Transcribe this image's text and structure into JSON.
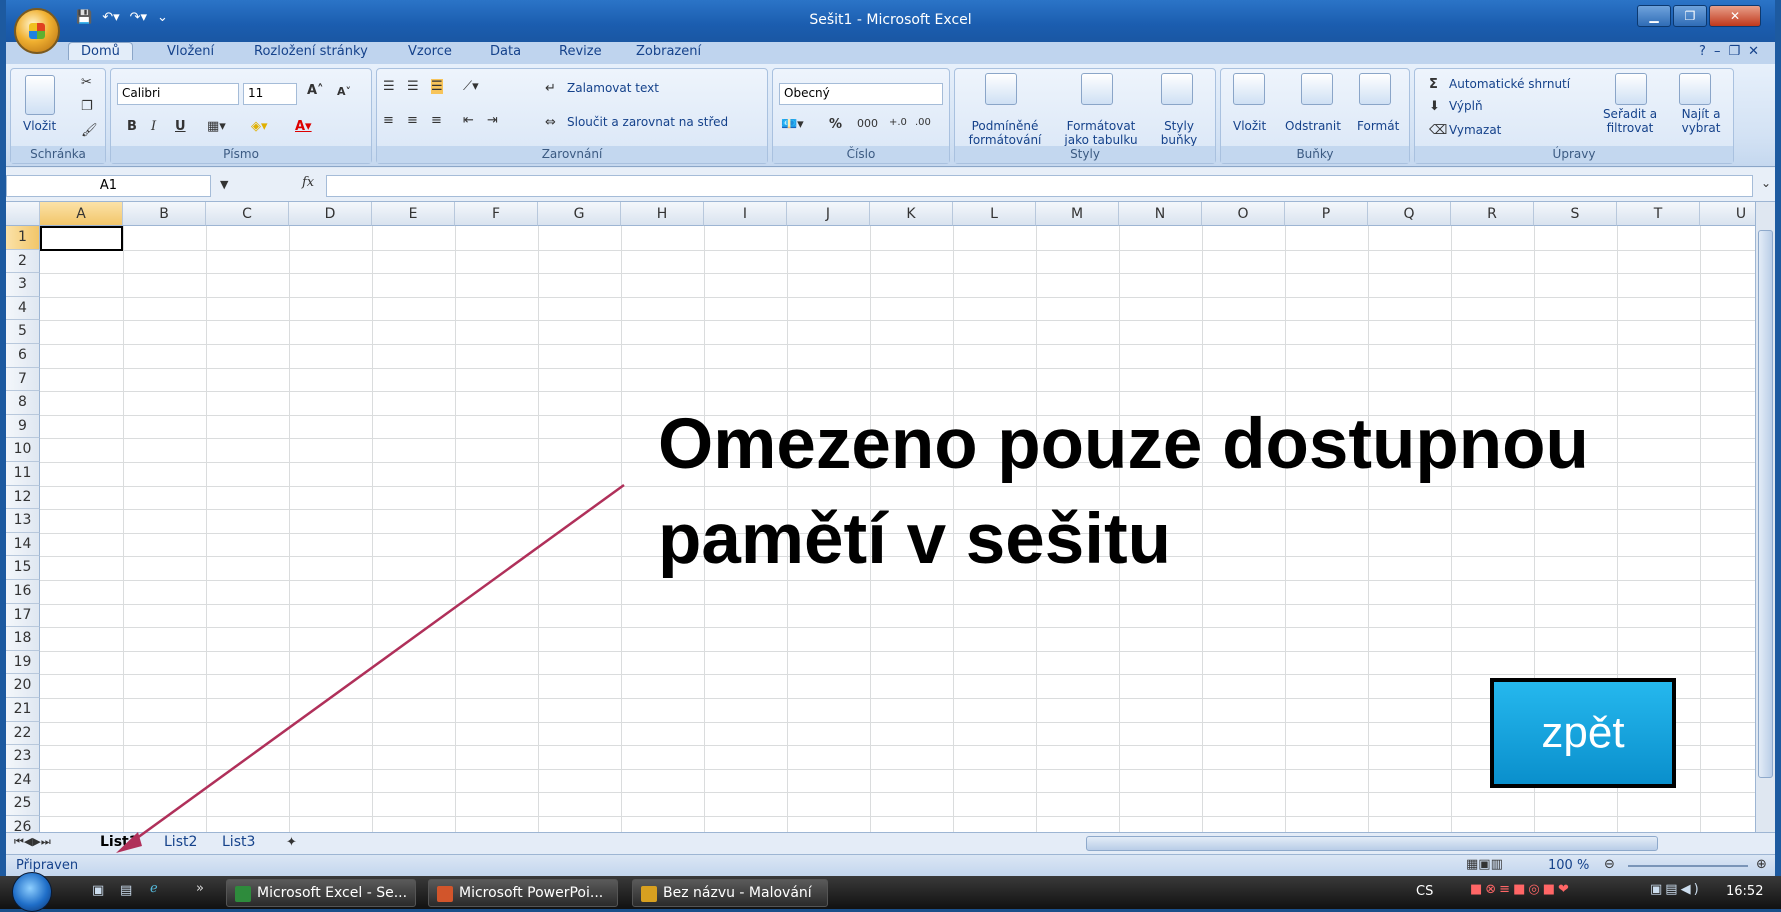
{
  "window": {
    "title": "Sešit1 - Microsoft Excel"
  },
  "ribbon_tabs": [
    "Domů",
    "Vložení",
    "Rozložení stránky",
    "Vzorce",
    "Data",
    "Revize",
    "Zobrazení"
  ],
  "ribbon": {
    "clipboard": {
      "paste": "Vložit",
      "caption": "Schránka"
    },
    "font": {
      "name": "Calibri",
      "size": "11",
      "bold": "B",
      "italic": "I",
      "underline": "U",
      "caption": "Písmo"
    },
    "alignment": {
      "wrap": "Zalamovat text",
      "merge": "Sloučit a zarovnat na střed",
      "caption": "Zarovnání"
    },
    "number": {
      "format": "Obecný",
      "percent": "%",
      "thousands": "000",
      "caption": "Číslo"
    },
    "styles": {
      "conditional": "Podmíněné formátování",
      "as_table": "Formátovat jako tabulku",
      "cell_styles": "Styly buňky",
      "caption": "Styly"
    },
    "cells": {
      "insert": "Vložit",
      "delete": "Odstranit",
      "format": "Formát",
      "caption": "Buňky"
    },
    "editing": {
      "autosum": "Automatické shrnutí",
      "fill": "Výplň",
      "clear": "Vymazat",
      "sort": "Seřadit a filtrovat",
      "find": "Najít a vybrat",
      "caption": "Úpravy"
    }
  },
  "formula_bar": {
    "name_box": "A1",
    "fx": "fx",
    "value": ""
  },
  "columns": [
    "A",
    "B",
    "C",
    "D",
    "E",
    "F",
    "G",
    "H",
    "I",
    "J",
    "K",
    "L",
    "M",
    "N",
    "O",
    "P",
    "Q",
    "R",
    "S",
    "T",
    "U"
  ],
  "rows": [
    "1",
    "2",
    "3",
    "4",
    "5",
    "6",
    "7",
    "8",
    "9",
    "10",
    "11",
    "12",
    "13",
    "14",
    "15",
    "16",
    "17",
    "18",
    "19",
    "20",
    "21",
    "22",
    "23",
    "24",
    "25",
    "26"
  ],
  "sheets": [
    "List1",
    "List2",
    "List3"
  ],
  "status": {
    "ready": "Připraven",
    "zoom": "100 %"
  },
  "overlay": {
    "line1": "Omezeno pouze dostupnou",
    "line2": "pamětí v sešitu",
    "back_button": "zpět"
  },
  "taskbar": {
    "items": [
      "Microsoft Excel - Se...",
      "Microsoft PowerPoi...",
      "Bez názvu - Malování"
    ],
    "language": "CS",
    "time": "16:52"
  },
  "colors": {
    "accent": "#15428b",
    "back_button": "#14a6df",
    "arrow": "#b0305a"
  }
}
